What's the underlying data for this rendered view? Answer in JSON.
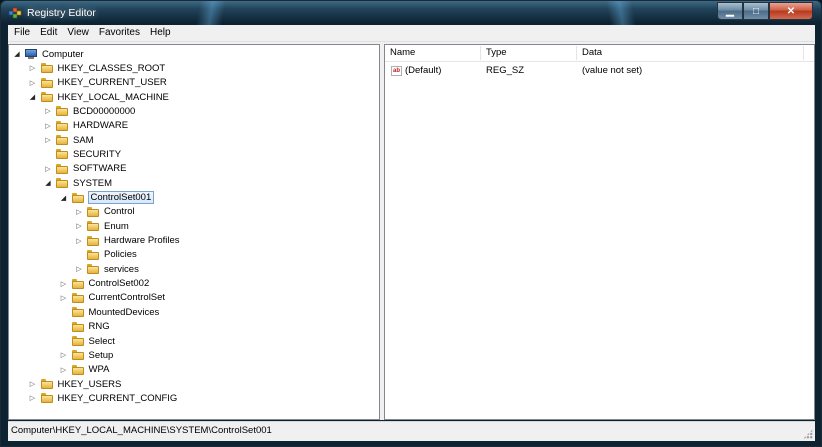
{
  "window": {
    "title": "Registry Editor",
    "minimize_glyph": "▁",
    "maximize_glyph": "□",
    "close_glyph": "✕"
  },
  "menu": [
    "File",
    "Edit",
    "View",
    "Favorites",
    "Help"
  ],
  "tree": [
    {
      "label": "Computer",
      "level": 0,
      "expander": "open",
      "icon": "computer-icon"
    },
    {
      "label": "HKEY_CLASSES_ROOT",
      "level": 1,
      "expander": "closed",
      "icon": "folder-icon"
    },
    {
      "label": "HKEY_CURRENT_USER",
      "level": 1,
      "expander": "closed",
      "icon": "folder-icon"
    },
    {
      "label": "HKEY_LOCAL_MACHINE",
      "level": 1,
      "expander": "open",
      "icon": "folder-icon"
    },
    {
      "label": "BCD00000000",
      "level": 2,
      "expander": "closed",
      "icon": "folder-icon"
    },
    {
      "label": "HARDWARE",
      "level": 2,
      "expander": "closed",
      "icon": "folder-icon"
    },
    {
      "label": "SAM",
      "level": 2,
      "expander": "closed",
      "icon": "folder-icon"
    },
    {
      "label": "SECURITY",
      "level": 2,
      "expander": "none",
      "icon": "folder-icon"
    },
    {
      "label": "SOFTWARE",
      "level": 2,
      "expander": "closed",
      "icon": "folder-icon"
    },
    {
      "label": "SYSTEM",
      "level": 2,
      "expander": "open",
      "icon": "folder-icon"
    },
    {
      "label": "ControlSet001",
      "level": 3,
      "expander": "open",
      "icon": "folder-icon",
      "selected": true
    },
    {
      "label": "Control",
      "level": 4,
      "expander": "closed",
      "icon": "folder-icon"
    },
    {
      "label": "Enum",
      "level": 4,
      "expander": "closed",
      "icon": "folder-icon"
    },
    {
      "label": "Hardware Profiles",
      "level": 4,
      "expander": "closed",
      "icon": "folder-icon"
    },
    {
      "label": "Policies",
      "level": 4,
      "expander": "none",
      "icon": "folder-icon"
    },
    {
      "label": "services",
      "level": 4,
      "expander": "closed",
      "icon": "folder-icon"
    },
    {
      "label": "ControlSet002",
      "level": 3,
      "expander": "closed",
      "icon": "folder-icon"
    },
    {
      "label": "CurrentControlSet",
      "level": 3,
      "expander": "closed",
      "icon": "folder-icon"
    },
    {
      "label": "MountedDevices",
      "level": 3,
      "expander": "none",
      "icon": "folder-icon"
    },
    {
      "label": "RNG",
      "level": 3,
      "expander": "none",
      "icon": "folder-icon"
    },
    {
      "label": "Select",
      "level": 3,
      "expander": "none",
      "icon": "folder-icon"
    },
    {
      "label": "Setup",
      "level": 3,
      "expander": "closed",
      "icon": "folder-icon"
    },
    {
      "label": "WPA",
      "level": 3,
      "expander": "closed",
      "icon": "folder-icon"
    },
    {
      "label": "HKEY_USERS",
      "level": 1,
      "expander": "closed",
      "icon": "folder-icon"
    },
    {
      "label": "HKEY_CURRENT_CONFIG",
      "level": 1,
      "expander": "closed",
      "icon": "folder-icon"
    }
  ],
  "list": {
    "columns": [
      "Name",
      "Type",
      "Data"
    ],
    "rows": [
      {
        "icon": "string-value-icon",
        "icon_text": "ab",
        "name": "(Default)",
        "type": "REG_SZ",
        "data": "(value not set)"
      }
    ]
  },
  "status": {
    "path": "Computer\\HKEY_LOCAL_MACHINE\\SYSTEM\\ControlSet001"
  }
}
